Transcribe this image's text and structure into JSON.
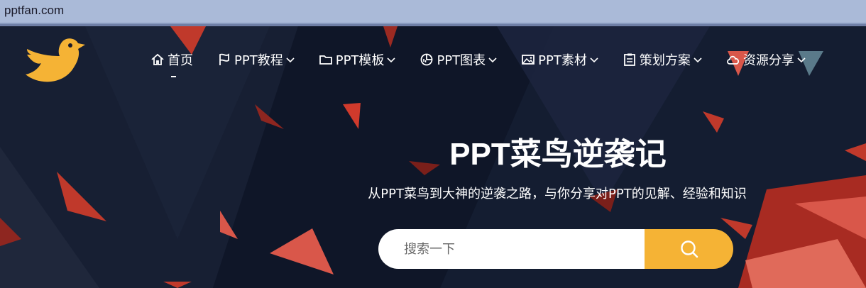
{
  "browser": {
    "url": "pptfan.com"
  },
  "nav": {
    "items": [
      {
        "label": "首页",
        "icon": "home-icon",
        "has_dropdown": false
      },
      {
        "label": "PPT教程",
        "icon": "flag-icon",
        "has_dropdown": true
      },
      {
        "label": "PPT模板",
        "icon": "folder-icon",
        "has_dropdown": true
      },
      {
        "label": "PPT图表",
        "icon": "chart-icon",
        "has_dropdown": true
      },
      {
        "label": "PPT素材",
        "icon": "image-icon",
        "has_dropdown": true
      },
      {
        "label": "策划方案",
        "icon": "clipboard-icon",
        "has_dropdown": true
      },
      {
        "label": "资源分享",
        "icon": "cloud-icon",
        "has_dropdown": true
      }
    ]
  },
  "hero": {
    "title": "PPT菜鸟逆袭记",
    "subtitle": "从PPT菜鸟到大神的逆袭之路，与你分享对PPT的见解、经验和知识"
  },
  "search": {
    "placeholder": "搜索一下"
  },
  "colors": {
    "accent": "#f5b335",
    "logo": "#f5b335",
    "background": "#121a2c",
    "triangle": "#c0392b"
  }
}
